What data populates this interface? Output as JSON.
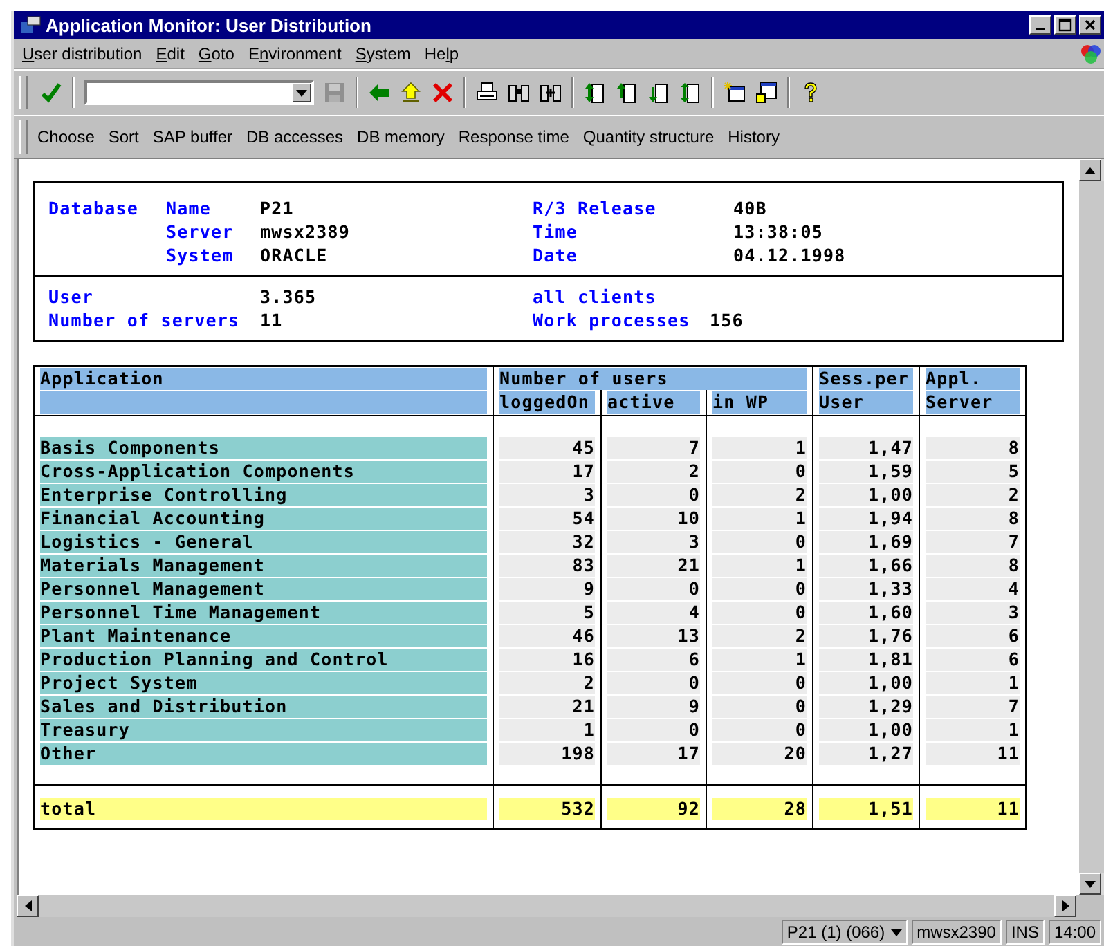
{
  "window": {
    "title": "Application Monitor: User Distribution"
  },
  "menu": [
    {
      "key": "U",
      "after": "ser distribution"
    },
    {
      "key": "E",
      "after": "dit"
    },
    {
      "key": "G",
      "after": "oto"
    },
    {
      "before": "E",
      "key": "n",
      "after": "vironment"
    },
    {
      "key": "S",
      "after": "ystem"
    },
    {
      "before": "He",
      "key": "l",
      "after": "p"
    }
  ],
  "app_toolbar": [
    "Choose",
    "Sort",
    "SAP buffer",
    "DB accesses",
    "DB memory",
    "Response time",
    "Quantity structure",
    "History"
  ],
  "header": {
    "database_label": "Database",
    "left": [
      {
        "label": "Name",
        "value": "P21"
      },
      {
        "label": "Server",
        "value": "mwsx2389"
      },
      {
        "label": "System",
        "value": "ORACLE"
      }
    ],
    "right": [
      {
        "label": "R/3 Release",
        "value": "40B"
      },
      {
        "label": "Time",
        "value": "13:38:05"
      },
      {
        "label": "Date",
        "value": "04.12.1998"
      }
    ]
  },
  "summary": {
    "left": [
      {
        "label": "User",
        "value": "3.365"
      },
      {
        "label": "Number of servers",
        "value": "11"
      }
    ],
    "right": [
      {
        "label": "all clients"
      },
      {
        "label": "Work processes",
        "value": "156"
      }
    ]
  },
  "table": {
    "columns": [
      {
        "label": "Application"
      },
      {
        "label": "Number of users",
        "sub": [
          "loggedOn",
          "active",
          "in WP"
        ]
      },
      {
        "label": "Sess.per",
        "second_line": "User"
      },
      {
        "label": "Appl.",
        "second_line": "Server"
      }
    ],
    "rows": [
      {
        "application": "Basis Components",
        "values": [
          "45",
          "7",
          "1",
          "1,47",
          "8"
        ]
      },
      {
        "application": "Cross-Application Components",
        "values": [
          "17",
          "2",
          "0",
          "1,59",
          "5"
        ]
      },
      {
        "application": "Enterprise Controlling",
        "values": [
          "3",
          "0",
          "2",
          "1,00",
          "2"
        ]
      },
      {
        "application": "Financial Accounting",
        "values": [
          "54",
          "10",
          "1",
          "1,94",
          "8"
        ]
      },
      {
        "application": "Logistics - General",
        "values": [
          "32",
          "3",
          "0",
          "1,69",
          "7"
        ]
      },
      {
        "application": "Materials Management",
        "values": [
          "83",
          "21",
          "1",
          "1,66",
          "8"
        ]
      },
      {
        "application": "Personnel Management",
        "values": [
          "9",
          "0",
          "0",
          "1,33",
          "4"
        ]
      },
      {
        "application": "Personnel Time Management",
        "values": [
          "5",
          "4",
          "0",
          "1,60",
          "3"
        ]
      },
      {
        "application": "Plant Maintenance",
        "values": [
          "46",
          "13",
          "2",
          "1,76",
          "6"
        ]
      },
      {
        "application": "Production Planning and Control",
        "values": [
          "16",
          "6",
          "1",
          "1,81",
          "6"
        ]
      },
      {
        "application": "Project System",
        "values": [
          "2",
          "0",
          "0",
          "1,00",
          "1"
        ]
      },
      {
        "application": "Sales and Distribution",
        "values": [
          "21",
          "9",
          "0",
          "1,29",
          "7"
        ]
      },
      {
        "application": "Treasury",
        "values": [
          "1",
          "0",
          "0",
          "1,00",
          "1"
        ]
      },
      {
        "application": "Other",
        "values": [
          "198",
          "17",
          "20",
          "1,27",
          "11"
        ]
      }
    ],
    "total": {
      "label": "total",
      "values": [
        "532",
        "92",
        "28",
        "1,51",
        "11"
      ]
    }
  },
  "status_bar": {
    "session": "P21 (1) (066)",
    "server": "mwsx2390",
    "mode": "INS",
    "time": "14:00"
  }
}
